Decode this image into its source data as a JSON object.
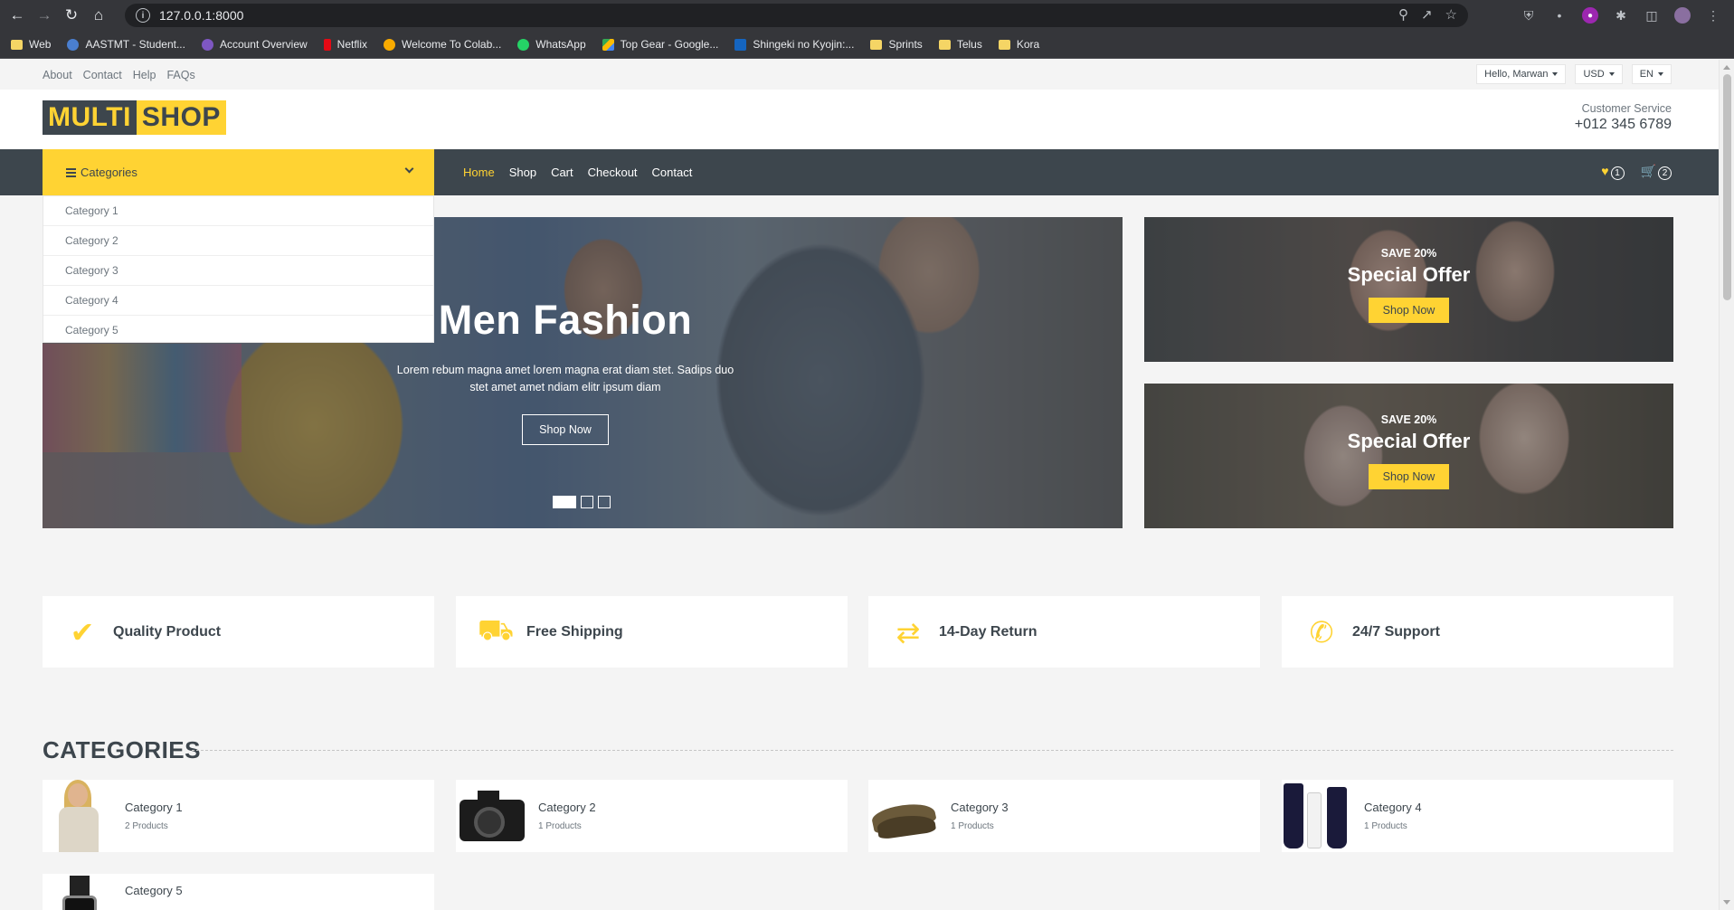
{
  "browser": {
    "url": "127.0.0.1:8000",
    "bookmarks": [
      {
        "label": "Web",
        "icon": "folder"
      },
      {
        "label": "AASTMT - Student...",
        "icon": "blue"
      },
      {
        "label": "Account Overview",
        "icon": "purple"
      },
      {
        "label": "Netflix",
        "icon": "red"
      },
      {
        "label": "Welcome To Colab...",
        "icon": "orange"
      },
      {
        "label": "WhatsApp",
        "icon": "green"
      },
      {
        "label": "Top Gear - Google...",
        "icon": "tri"
      },
      {
        "label": "Shingeki no Kyojin:...",
        "icon": "navy"
      },
      {
        "label": "Sprints",
        "icon": "folder"
      },
      {
        "label": "Telus",
        "icon": "folder"
      },
      {
        "label": "Kora",
        "icon": "folder"
      }
    ]
  },
  "topbar": {
    "links": [
      "About",
      "Contact",
      "Help",
      "FAQs"
    ],
    "user": "Hello, Marwan",
    "currency": "USD",
    "language": "EN"
  },
  "header": {
    "logo_part1": "MULTI",
    "logo_part2": "SHOP",
    "service_label": "Customer Service",
    "phone": "+012 345 6789"
  },
  "navbar": {
    "categories_label": "Categories",
    "links": [
      "Home",
      "Shop",
      "Cart",
      "Checkout",
      "Contact"
    ],
    "active": "Home",
    "wishlist_count": "1",
    "cart_count": "2"
  },
  "category_dropdown": [
    "Category 1",
    "Category 2",
    "Category 3",
    "Category 4",
    "Category 5"
  ],
  "hero": {
    "title": "Men Fashion",
    "text": "Lorem rebum magna amet lorem magna erat diam stet. Sadips duo stet amet amet ndiam elitr ipsum diam",
    "button": "Shop Now",
    "slide_count": 3,
    "active_slide": 1
  },
  "offers": [
    {
      "save": "SAVE 20%",
      "title": "Special Offer",
      "button": "Shop Now"
    },
    {
      "save": "SAVE 20%",
      "title": "Special Offer",
      "button": "Shop Now"
    }
  ],
  "features": [
    {
      "label": "Quality Product",
      "icon": "check-icon"
    },
    {
      "label": "Free Shipping",
      "icon": "shipping-truck-icon"
    },
    {
      "label": "14-Day Return",
      "icon": "exchange-arrows-icon"
    },
    {
      "label": "24/7 Support",
      "icon": "phone-volume-icon"
    }
  ],
  "categories_section": {
    "title": "CATEGORIES",
    "items": [
      {
        "name": "Category 1",
        "count": "2 Products"
      },
      {
        "name": "Category 2",
        "count": "1 Products"
      },
      {
        "name": "Category 3",
        "count": "1 Products"
      },
      {
        "name": "Category 4",
        "count": "1 Products"
      },
      {
        "name": "Category 5",
        "count": ""
      }
    ]
  },
  "colors": {
    "primary": "#ffd333",
    "dark": "#3d464d",
    "background": "#f4f4f4"
  }
}
